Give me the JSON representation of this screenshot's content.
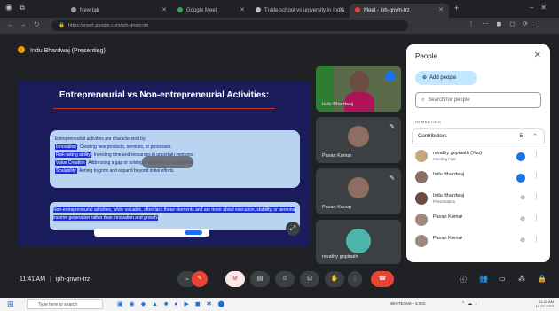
{
  "browser": {
    "tabs": [
      {
        "title": "New tab"
      },
      {
        "title": "Google Meet"
      },
      {
        "title": "Trade school vs university in India"
      },
      {
        "title": "Meet - iph-qnwn-trz"
      }
    ],
    "address": "https://meet.google.com/iph-qnwn-trz"
  },
  "meet": {
    "presenting_label": "Indu Bhardwaj (Presenting)",
    "meeting_time": "11:41 AM",
    "meeting_code": "iph-qnwn-trz"
  },
  "slide": {
    "title": "Entrepreneurial vs Non-entrepreneurial Activities:",
    "intro": "Entrepreneurial activities are characterized by:",
    "points": [
      {
        "term": "Innovation",
        "text": "Creating new products, services, or processes."
      },
      {
        "term": "Risk-taking ability",
        "text": "Investing time and resources in uncertain ventures."
      },
      {
        "term": "Value Creation",
        "text": "Addressing a gap or solving a problem for customers."
      },
      {
        "term": "Scalability",
        "text": "Aiming to grow and expand beyond initial efforts."
      }
    ],
    "paragraph": "Non-entrepreneurial activities, while valuable, often lack these elements and are more about execution, stability, or personal income generation rather than innovation and growth."
  },
  "tiles": [
    {
      "name": "Indu Bhardwaj"
    },
    {
      "name": "Pavan Kumar"
    },
    {
      "name": "Pavan Kumar"
    },
    {
      "name": "revathy gopinath"
    }
  ],
  "people_panel": {
    "title": "People",
    "add_people": "Add people",
    "search_placeholder": "Search for people",
    "section_label": "IN MEETING",
    "group_label": "Contributors",
    "group_count": "5",
    "participants": [
      {
        "name": "revathy gopinath (You)",
        "subtitle": "Meeting host"
      },
      {
        "name": "Indu Bhardwaj",
        "subtitle": ""
      },
      {
        "name": "Indu Bhardwaj",
        "subtitle": "Presentation"
      },
      {
        "name": "Pavan Kumar",
        "subtitle": ""
      },
      {
        "name": "Pavan Kumar",
        "subtitle": ""
      }
    ]
  },
  "taskbar": {
    "search_placeholder": "Type here to search",
    "weather": "WHITEANS • 1:00C",
    "time": "11:41 AM",
    "date": "13-04-2023"
  },
  "colors": {
    "slide_bg": "#1a1c5c",
    "callout_bg": "#b9d4f0",
    "highlight": "#1c2fd9",
    "leave": "#ea4335",
    "accent": "#1a73e8"
  }
}
